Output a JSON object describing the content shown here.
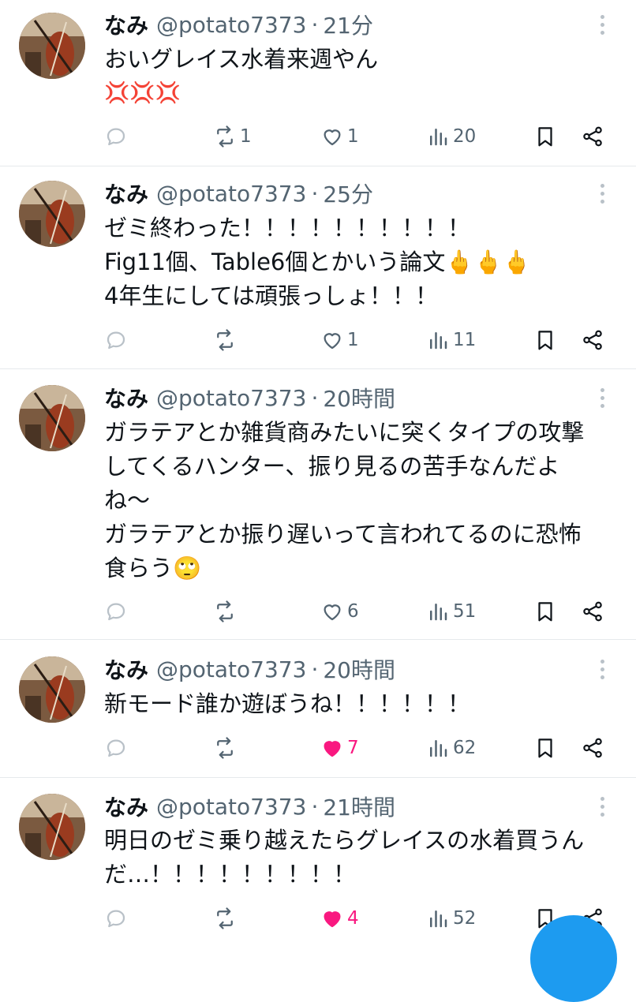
{
  "colors": {
    "accent": "#1d9bf0",
    "like": "#f91880",
    "muted": "#536471",
    "text": "#0f1419"
  },
  "icons": [
    "reply-icon",
    "retweet-icon",
    "heart-icon",
    "views-icon",
    "bookmark-icon",
    "share-icon",
    "more-icon",
    "anger-emoji",
    "finger-emoji",
    "eyeroll-emoji"
  ],
  "tweets": [
    {
      "name": "なみ",
      "handle": "@potato7373",
      "sep": "·",
      "time": "21分",
      "lines": [
        "おいグレイス水着来週やん",
        "💢💢💢"
      ],
      "retweets": "1",
      "likes": "1",
      "views": "20",
      "liked": false
    },
    {
      "name": "なみ",
      "handle": "@potato7373",
      "sep": "·",
      "time": "25分",
      "lines": [
        "ゼミ終わった！！！！！！！！！！",
        "Fig11個、Table6個とかいう論文🖕🖕🖕",
        "4年生にしては頑張っしょ！！！"
      ],
      "retweets": "",
      "likes": "1",
      "views": "11",
      "liked": false
    },
    {
      "name": "なみ",
      "handle": "@potato7373",
      "sep": "·",
      "time": "20時間",
      "lines": [
        "ガラテアとか雑貨商みたいに突くタイプの攻撃",
        "してくるハンター、振り見るの苦手なんだよ",
        "ね〜",
        "ガラテアとか振り遅いって言われてるのに恐怖",
        "食らう🙄"
      ],
      "retweets": "",
      "likes": "6",
      "views": "51",
      "liked": false
    },
    {
      "name": "なみ",
      "handle": "@potato7373",
      "sep": "·",
      "time": "20時間",
      "lines": [
        "新モード誰か遊ぼうね！！！！！！"
      ],
      "retweets": "",
      "likes": "7",
      "views": "62",
      "liked": true
    },
    {
      "name": "なみ",
      "handle": "@potato7373",
      "sep": "·",
      "time": "21時間",
      "lines": [
        "明日のゼミ乗り越えたらグレイスの水着買うん",
        "だ…！！！！！！！！！"
      ],
      "retweets": "",
      "likes": "4",
      "views": "52",
      "liked": true
    }
  ]
}
